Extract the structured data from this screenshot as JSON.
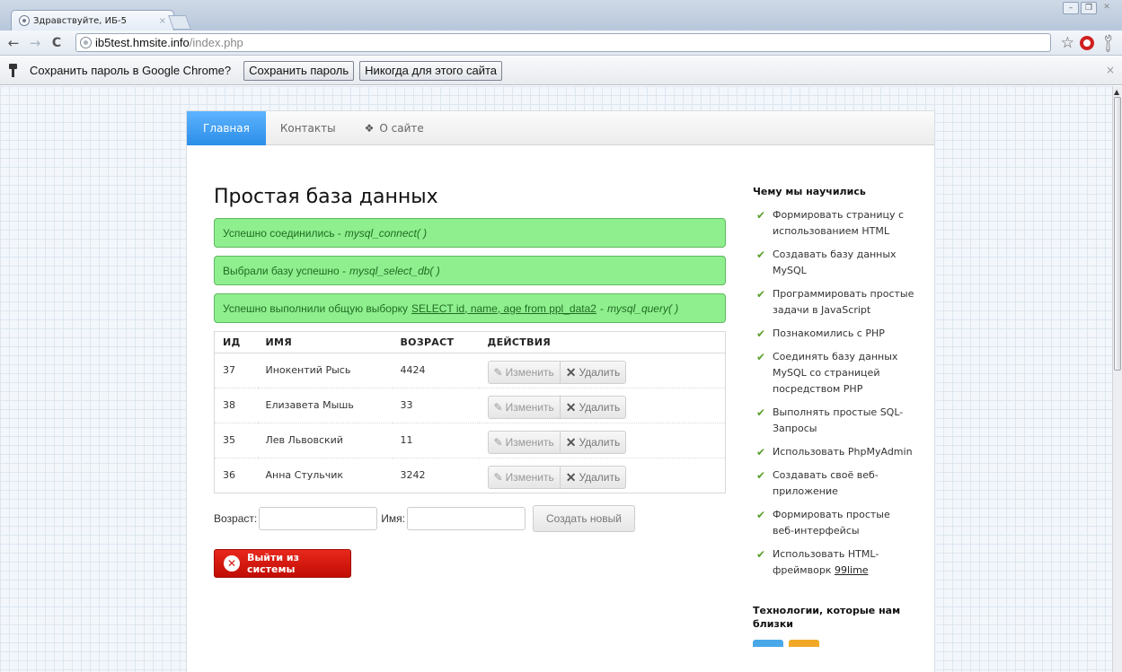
{
  "browser": {
    "tab_title": "Здравствуйте, ИБ-5",
    "tab_close": "×",
    "url_host": "ib5test.hmsite.info",
    "url_path": "/index.php",
    "infobar": {
      "text": "Сохранить пароль в Google Chrome?",
      "save_button": "Сохранить пароль",
      "never_button": "Никогда для этого сайта",
      "close": "×"
    }
  },
  "nav": {
    "items": [
      "Главная",
      "Контакты",
      "О сайте"
    ]
  },
  "main": {
    "title": "Простая база данных",
    "alerts": [
      {
        "text": "Успешно соединились -",
        "fn": "mysql_connect( )"
      },
      {
        "text": "Выбрали базу успешно -",
        "fn": "mysql_select_db( )"
      },
      {
        "text": "Успешно выполнили общую выборку",
        "sql": "SELECT id, name, age from ppl_data2",
        "sep": "-",
        "fn": "mysql_query( )"
      }
    ],
    "table": {
      "headers": [
        "ИД",
        "ИМЯ",
        "ВОЗРАСТ",
        "ДЕЙСТВИЯ"
      ],
      "rows": [
        {
          "id": "37",
          "name": "Инокентий Рысь",
          "age": "4424"
        },
        {
          "id": "38",
          "name": "Елизавета Мышь",
          "age": "33"
        },
        {
          "id": "35",
          "name": "Лев Львовский",
          "age": "11"
        },
        {
          "id": "36",
          "name": "Анна Стульчик",
          "age": "3242"
        }
      ],
      "edit_label": "Изменить",
      "delete_label": "Удалить"
    },
    "form": {
      "age_label": "Возраст:",
      "name_label": "Имя:",
      "age_value": "",
      "name_value": "",
      "submit_label": "Создать новый"
    },
    "logout_label": "Выйти из системы"
  },
  "sidebar": {
    "heading": "Чему мы научились",
    "items": [
      "Формировать страницу с использованием HTML",
      "Создавать базу данных MySQL",
      "Программировать простые задачи в JavaScript",
      "Познакомились с PHP",
      "Соединять базу данных MySQL со страницей посредством PHP",
      "Выполнять простые SQL-Запросы",
      "Использовать PhpMyAdmin",
      "Создавать своё веб-приложение",
      "Формировать простые веб-интерфейсы"
    ],
    "last_item_text": "Использовать HTML-фреймворк",
    "last_item_link": "99lime",
    "heading2": "Технологии, которые нам близки"
  },
  "colors": {
    "nav_active": "#2b8ee8",
    "alert_bg": "#8fef8f",
    "logout_bg": "#d21a10",
    "check": "#5aa02c"
  }
}
